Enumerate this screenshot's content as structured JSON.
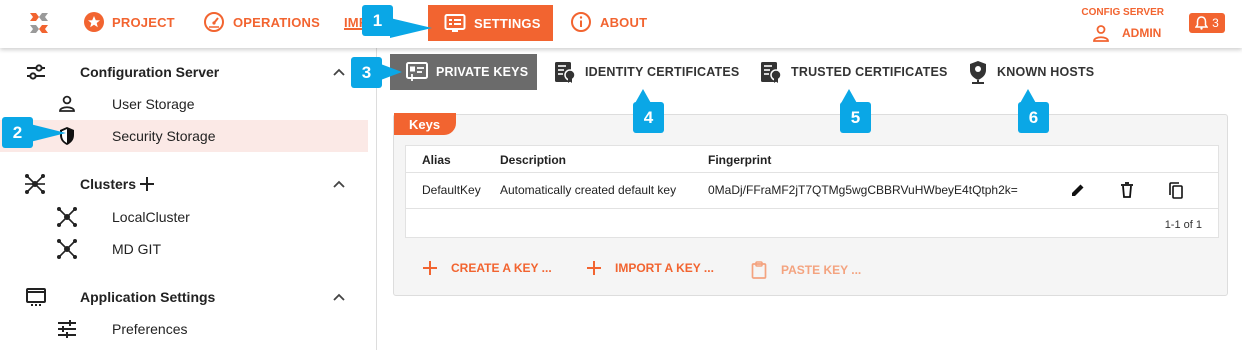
{
  "topbar": {
    "nav": [
      {
        "label": "PROJECT",
        "icon": "star-circle-icon"
      },
      {
        "label": "OPERATIONS",
        "icon": "speedometer-icon"
      },
      {
        "label": "IMPORT FILE",
        "icon": "import-icon"
      },
      {
        "label": "SETTINGS",
        "icon": "settings-panel-icon"
      },
      {
        "label": "ABOUT",
        "icon": "info-icon"
      }
    ],
    "partial_label": "IMFILE",
    "config_label": "CONFIG SERVER",
    "admin_label": "ADMIN",
    "notification_count": "3"
  },
  "sidebar": {
    "groups": [
      {
        "label": "Configuration Server",
        "items": [
          "User Storage",
          "Security Storage"
        ]
      },
      {
        "label": "Clusters",
        "items": [
          "LocalCluster",
          "MD GIT"
        ]
      },
      {
        "label": "Application Settings",
        "items": [
          "Preferences"
        ]
      }
    ]
  },
  "tabs": [
    {
      "label": "PRIVATE KEYS",
      "active": true
    },
    {
      "label": "IDENTITY CERTIFICATES"
    },
    {
      "label": "TRUSTED CERTIFICATES"
    },
    {
      "label": "KNOWN HOSTS"
    }
  ],
  "card": {
    "title": "Keys",
    "columns": [
      "Alias",
      "Description",
      "Fingerprint"
    ],
    "rows": [
      {
        "alias": "DefaultKey",
        "description": "Automatically created default key",
        "fingerprint": "0MaDj/FFraMF2jT7QTMg5wgCBBRVuHWbeyE4tQtph2k="
      }
    ],
    "pager": "1-1 of 1",
    "actions": [
      "CREATE A KEY ...",
      "IMPORT A KEY ...",
      "PASTE KEY ..."
    ]
  },
  "callouts": [
    "1",
    "2",
    "3",
    "4",
    "5",
    "6"
  ],
  "colors": {
    "accent": "#f26430",
    "callout": "#0aa7e6",
    "active_tab": "#6b6b6b",
    "selected_row": "#fbe9e6"
  }
}
